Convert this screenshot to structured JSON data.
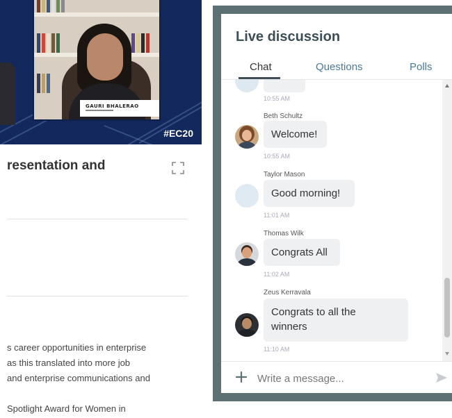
{
  "video": {
    "speaker_name": "GAURI BHALERAO",
    "hashtag": "#EC20"
  },
  "article": {
    "title": "resentation and",
    "paragraph1": [
      "s career opportunities in enterprise",
      "as this translated into more job",
      "and enterprise communications and"
    ],
    "paragraph2": "Spotlight Award for Women in"
  },
  "chat_panel": {
    "title": "Live discussion",
    "tabs": [
      {
        "label": "Chat",
        "active": true
      },
      {
        "label": "Questions",
        "active": false
      },
      {
        "label": "Polls",
        "active": false
      }
    ],
    "messages": [
      {
        "author": "",
        "text": "",
        "time": "10:55 AM",
        "avatar": "person-avatar",
        "partial": true
      },
      {
        "author": "Beth Schultz",
        "text": "Welcome!",
        "time": "10:55 AM",
        "avatar": "person-avatar"
      },
      {
        "author": "Taylor Mason",
        "text": "Good morning!",
        "time": "11:01 AM",
        "avatar": "initials-avatar"
      },
      {
        "author": "Thomas Wilk",
        "text": "Congrats All",
        "time": "11:02 AM",
        "avatar": "person-avatar"
      },
      {
        "author": "Zeus Kerravala",
        "text_lines": [
          "Congrats to all the",
          "winners"
        ],
        "time": "11:10 AM",
        "avatar": "person-avatar"
      }
    ],
    "composer": {
      "placeholder": "Write a message..."
    }
  },
  "colors": {
    "panel_frame": "#5d7175",
    "video_background": "#13285d",
    "title_text": "#3e4e57",
    "inactive_tab": "#4a7a9a",
    "bubble": "#eef0f2"
  }
}
